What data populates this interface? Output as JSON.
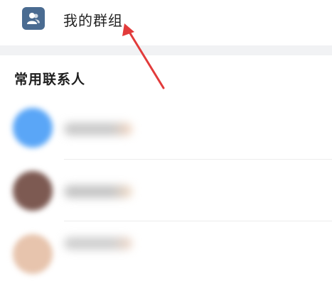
{
  "groups_row": {
    "label": "我的群组",
    "icon": "group-icon"
  },
  "section": {
    "title": "常用联系人"
  },
  "contacts": [
    {
      "avatar_color": "#5aa6f7",
      "name_color": "#c9c9c9",
      "name_accent": "#f6d7c1"
    },
    {
      "avatar_color": "#7d5a52",
      "name_color": "#c4c4c4",
      "name_accent": "#f4dcc6"
    },
    {
      "avatar_color": "#e7c4ad",
      "name_color": "#cfcfcf",
      "name_accent": "#f1d8c8"
    }
  ],
  "colors": {
    "icon_bg": "#4a6b91",
    "annotation_arrow": "#e23b3b",
    "section_gap": "#f1f2f4"
  }
}
